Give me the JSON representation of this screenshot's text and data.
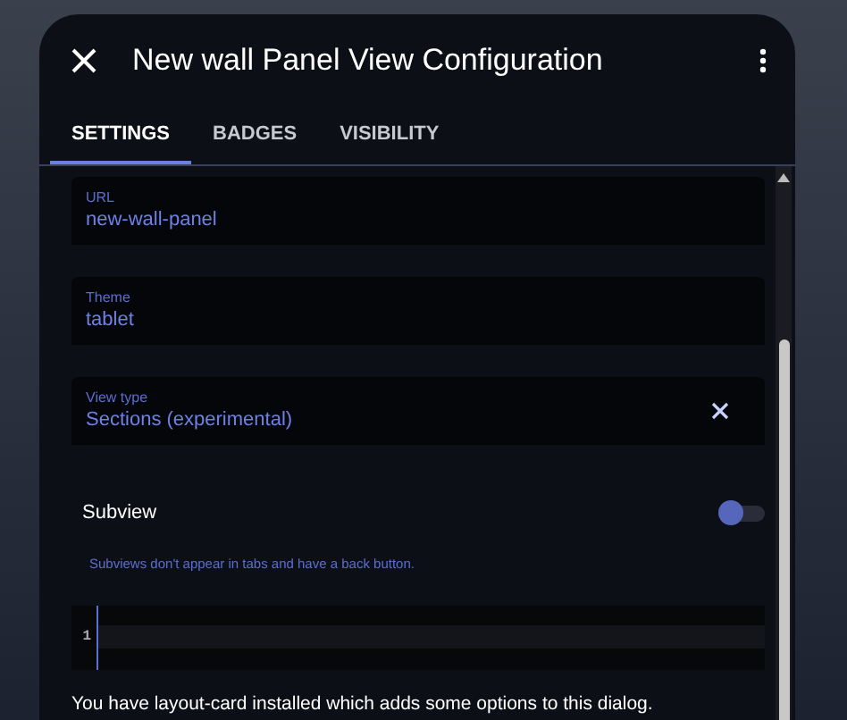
{
  "dialog": {
    "title": "New wall Panel View Configuration"
  },
  "tabs": [
    {
      "label": "SETTINGS",
      "selected": true
    },
    {
      "label": "BADGES",
      "selected": false
    },
    {
      "label": "VISIBILITY",
      "selected": false
    }
  ],
  "fields": [
    {
      "label": "URL",
      "value": "new-wall-panel",
      "clearable": false
    },
    {
      "label": "Theme",
      "value": "tablet",
      "clearable": false
    },
    {
      "label": "View type",
      "value": "Sections (experimental)",
      "clearable": true
    }
  ],
  "subview": {
    "label": "Subview",
    "on": false,
    "helper": "Subviews don't appear in tabs and have a back button."
  },
  "editor": {
    "line_numbers": [
      "1"
    ]
  },
  "note": "You have layout-card installed which adds some options to this dialog."
}
